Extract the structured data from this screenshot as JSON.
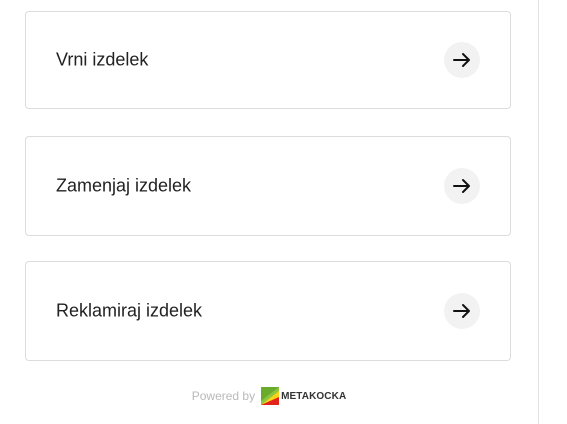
{
  "options": [
    {
      "label": "Vrni izdelek",
      "icon": "arrow-right-icon"
    },
    {
      "label": "Zamenjaj izdelek",
      "icon": "arrow-right-icon"
    },
    {
      "label": "Reklamiraj izdelek",
      "icon": "arrow-right-icon"
    }
  ],
  "footer": {
    "powered_by": "Powered by",
    "brand_name": "METAKOCKA",
    "brand_icon": "metakocka-logo-icon"
  },
  "colors": {
    "text": "#222222",
    "border": "#dcdcdc",
    "arrow_bg": "#f2f2f2",
    "powered_text": "#b9b9b9",
    "logo_green": "#8cc63f",
    "logo_yellow": "#f7d417",
    "logo_red": "#e2231a"
  }
}
